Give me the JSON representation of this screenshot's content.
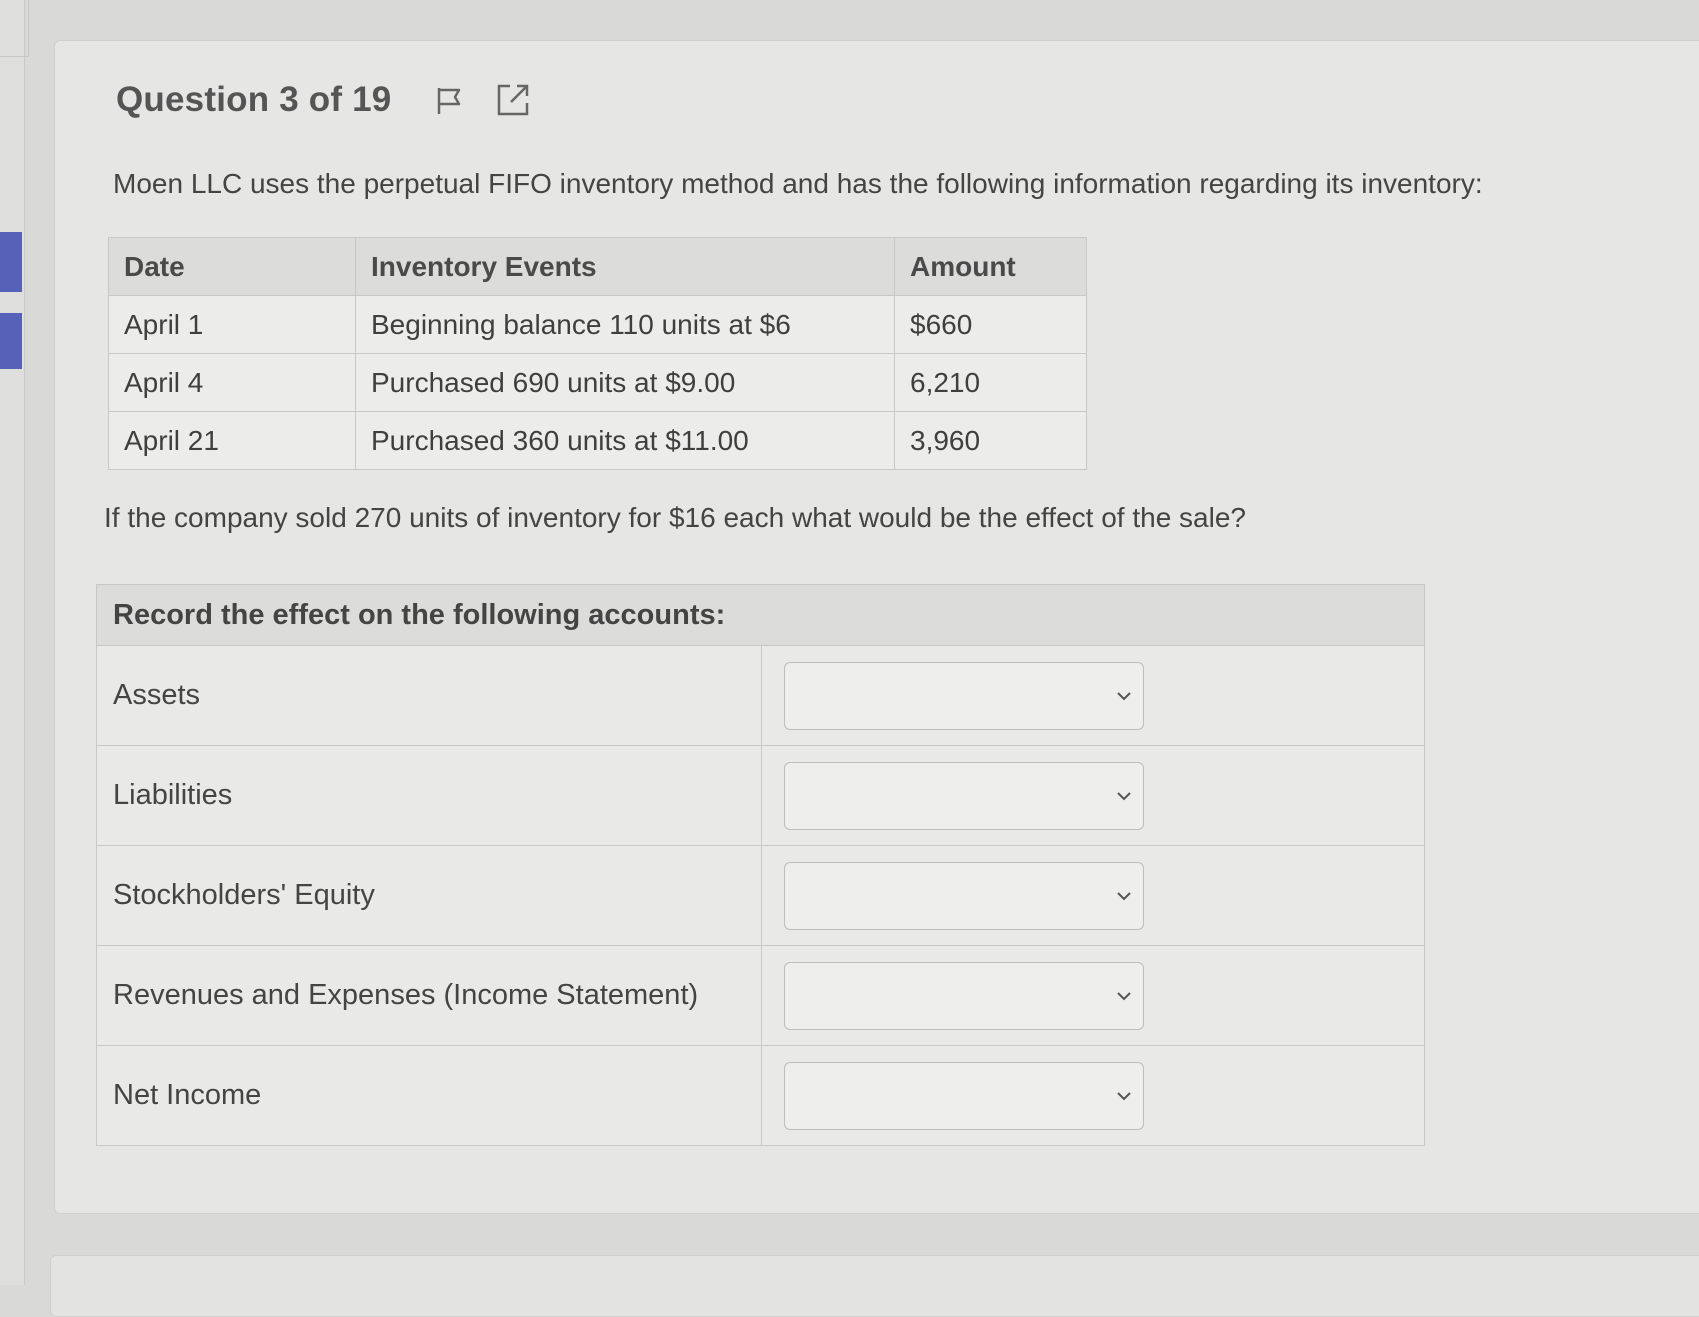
{
  "header": {
    "question_label": "Question 3 of 19",
    "flag_icon": "flag-icon",
    "open_icon": "external-link-icon"
  },
  "intro_text": "Moen LLC uses the perpetual FIFO inventory method and has the following information regarding its inventory:",
  "inventory_table": {
    "headers": {
      "date": "Date",
      "event": "Inventory Events",
      "amount": "Amount"
    },
    "rows": [
      {
        "date": "April 1",
        "event": "Beginning balance 110 units at $6",
        "amount": "$660"
      },
      {
        "date": "April 4",
        "event": "Purchased 690 units at $9.00",
        "amount": "6,210"
      },
      {
        "date": "April 21",
        "event": "Purchased 360 units at $11.00",
        "amount": "3,960"
      }
    ]
  },
  "question_text": "If the company sold 270 units of inventory for $16 each what would be the effect of the sale?",
  "effects_table": {
    "header": "Record the effect on the following accounts:",
    "rows": [
      {
        "label": "Assets",
        "selected": ""
      },
      {
        "label": "Liabilities",
        "selected": ""
      },
      {
        "label": "Stockholders' Equity",
        "selected": ""
      },
      {
        "label": "Revenues and Expenses (Income Statement)",
        "selected": ""
      },
      {
        "label": "Net Income",
        "selected": ""
      }
    ]
  },
  "colors": {
    "rail_accent": "#5562b8",
    "background": "#d9d9d7",
    "card": "#e6e6e4"
  }
}
